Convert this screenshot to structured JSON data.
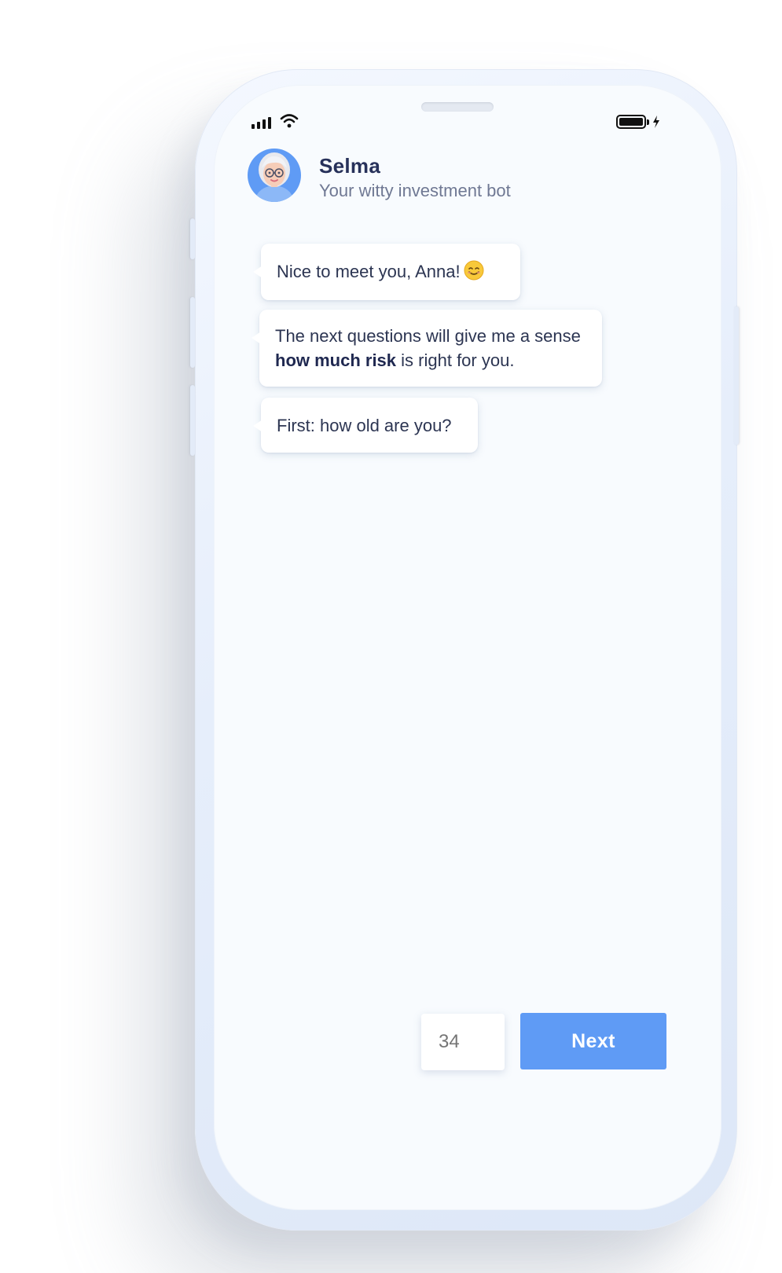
{
  "status_bar": {
    "signal_icon": "signal-bars-icon",
    "wifi_icon": "wifi-icon",
    "battery_icon": "battery-charging-icon"
  },
  "bot": {
    "name": "Selma",
    "subtitle": "Your witty investment bot",
    "avatar_icon": "avatar-woman-glasses"
  },
  "messages": [
    {
      "text": "Nice to meet you, Anna!",
      "emoji": "smiling-face-icon"
    },
    {
      "pre": "The next questions will give me a sense ",
      "bold": "how much risk",
      "post": " is right for you."
    },
    {
      "text": "First: how old are you?"
    }
  ],
  "input": {
    "placeholder": "34",
    "value": ""
  },
  "actions": {
    "next_label": "Next"
  },
  "colors": {
    "accent": "#5f9bf5",
    "text_dark": "#27315a",
    "text_muted": "#6f7893",
    "screen_bg": "#f8fbfe"
  }
}
